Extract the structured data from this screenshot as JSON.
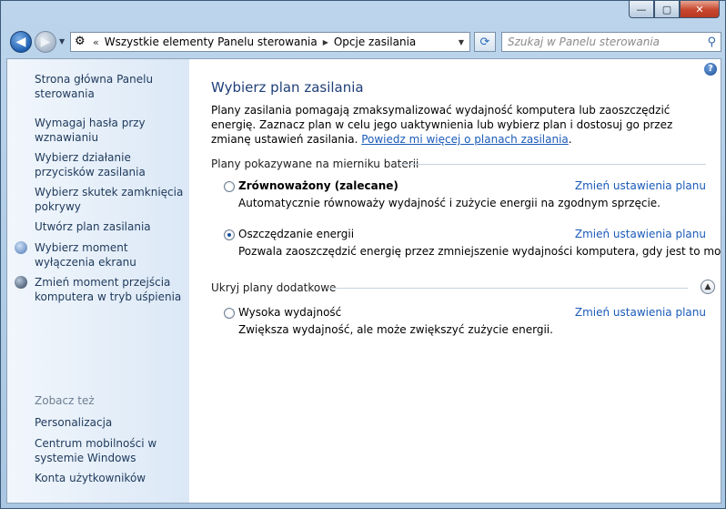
{
  "window": {
    "min": "—",
    "max": "▢",
    "close": "✕"
  },
  "address": {
    "chevron": "«",
    "crumb1": "Wszystkie elementy Panelu sterowania",
    "crumb2": "Opcje zasilania"
  },
  "search": {
    "placeholder": "Szukaj w Panelu sterowania"
  },
  "sidebar": {
    "home": "Strona główna Panelu sterowania",
    "items": [
      "Wymagaj hasła przy wznawianiu",
      "Wybierz działanie przycisków zasilania",
      "Wybierz skutek zamknięcia pokrywy",
      "Utwórz plan zasilania",
      "Wybierz moment wyłączenia ekranu",
      "Zmień moment przejścia komputera w tryb uśpienia"
    ],
    "see_also_title": "Zobacz też",
    "see_also": [
      "Personalizacja",
      "Centrum mobilności w systemie Windows",
      "Konta użytkowników"
    ]
  },
  "main": {
    "help": "?",
    "title": "Wybierz plan zasilania",
    "intro": "Plany zasilania pomagają zmaksymalizować wydajność komputera lub zaoszczędzić energię. Zaznacz plan w celu jego uaktywnienia lub wybierz plan i dostosuj go przez zmianę ustawień zasilania.",
    "intro_link": "Powiedz mi więcej o planach zasilania",
    "group1": "Plany pokazywane na mierniku baterii",
    "group2": "Ukryj plany dodatkowe",
    "change_label": "Zmień ustawienia planu",
    "plans": [
      {
        "name": "Zrównoważony (zalecane)",
        "desc": "Automatycznie równoważy wydajność i zużycie energii na zgodnym sprzęcie.",
        "checked": false
      },
      {
        "name": "Oszczędzanie energii",
        "desc": "Pozwala zaoszczędzić energię przez zmniejszenie wydajności komputera, gdy jest to możliwe.",
        "checked": true
      },
      {
        "name": "Wysoka wydajność",
        "desc": "Zwiększa wydajność, ale może zwiększyć zużycie energii.",
        "checked": false
      }
    ]
  }
}
